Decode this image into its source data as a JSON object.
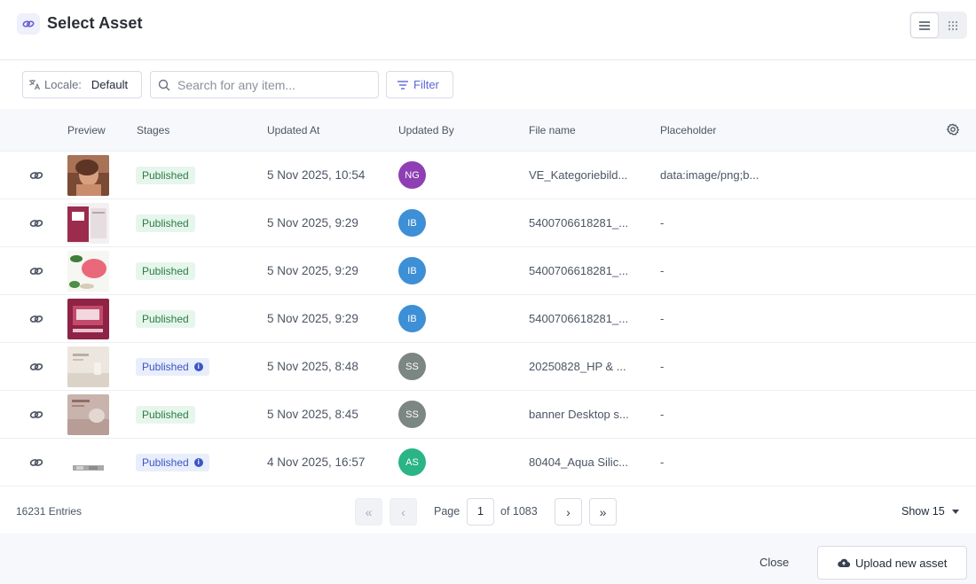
{
  "header": {
    "title": "Select Asset",
    "icon": "link-icon",
    "view_modes": [
      "list-view-icon",
      "grid-view-icon"
    ]
  },
  "toolbar": {
    "locale_label": "Locale:",
    "locale_value": "Default",
    "search_placeholder": "Search for any item...",
    "filter_label": "Filter"
  },
  "columns": {
    "preview": "Preview",
    "stages": "Stages",
    "updated_at": "Updated At",
    "updated_by": "Updated By",
    "file_name": "File name",
    "placeholder": "Placeholder"
  },
  "rows": [
    {
      "stage": "Published",
      "stage_style": "green",
      "stage_info": false,
      "updated_at": "5 Nov 2025, 10:54",
      "initials": "NG",
      "avatar_color": "#8e3fb3",
      "file_name": "VE_Kategoriebild...",
      "placeholder": "data:image/png;b..."
    },
    {
      "stage": "Published",
      "stage_style": "green",
      "stage_info": false,
      "updated_at": "5 Nov 2025, 9:29",
      "initials": "IB",
      "avatar_color": "#3d8fd6",
      "file_name": "5400706618281_...",
      "placeholder": "-"
    },
    {
      "stage": "Published",
      "stage_style": "green",
      "stage_info": false,
      "updated_at": "5 Nov 2025, 9:29",
      "initials": "IB",
      "avatar_color": "#3d8fd6",
      "file_name": "5400706618281_...",
      "placeholder": "-"
    },
    {
      "stage": "Published",
      "stage_style": "green",
      "stage_info": false,
      "updated_at": "5 Nov 2025, 9:29",
      "initials": "IB",
      "avatar_color": "#3d8fd6",
      "file_name": "5400706618281_...",
      "placeholder": "-"
    },
    {
      "stage": "Published",
      "stage_style": "blue",
      "stage_info": true,
      "updated_at": "5 Nov 2025, 8:48",
      "initials": "SS",
      "avatar_color": "#7c8683",
      "file_name": "20250828_HP & ...",
      "placeholder": "-"
    },
    {
      "stage": "Published",
      "stage_style": "green",
      "stage_info": false,
      "updated_at": "5 Nov 2025, 8:45",
      "initials": "SS",
      "avatar_color": "#7c8683",
      "file_name": "banner Desktop s...",
      "placeholder": "-"
    },
    {
      "stage": "Published",
      "stage_style": "blue",
      "stage_info": true,
      "updated_at": "4 Nov 2025, 16:57",
      "initials": "AS",
      "avatar_color": "#2bb486",
      "file_name": "80404_Aqua Silic...",
      "placeholder": "-"
    }
  ],
  "pagination": {
    "entries": "16231 Entries",
    "page_label": "Page",
    "page_value": "1",
    "of_label": "of 1083",
    "show_label": "Show 15"
  },
  "actions": {
    "close_label": "Close",
    "upload_label": "Upload new asset"
  }
}
